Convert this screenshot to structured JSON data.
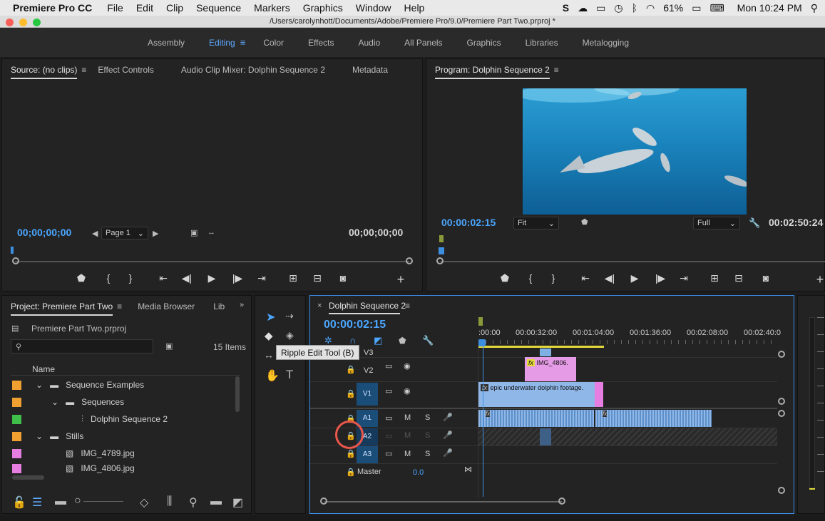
{
  "menubar": {
    "app": "Premiere Pro CC",
    "items": [
      "File",
      "Edit",
      "Clip",
      "Sequence",
      "Markers",
      "Graphics",
      "Window",
      "Help"
    ],
    "battery": "61%",
    "clock": "Mon 10:24 PM"
  },
  "window": {
    "title": "/Users/carolynhott/Documents/Adobe/Premiere Pro/9.0/Premiere Part Two.prproj *"
  },
  "workspaces": [
    "Assembly",
    "Editing",
    "Color",
    "Effects",
    "Audio",
    "All Panels",
    "Graphics",
    "Libraries",
    "Metalogging"
  ],
  "source": {
    "tabs": [
      "Source: (no clips)",
      "Effect Controls",
      "Audio Clip Mixer: Dolphin Sequence 2",
      "Metadata"
    ],
    "timecode_left": "00;00;00;00",
    "timecode_right": "00;00;00;00",
    "page_select": "Page 1"
  },
  "program": {
    "tab": "Program: Dolphin Sequence 2",
    "timecode": "00:00:02:15",
    "zoom": "Fit",
    "quality": "Full",
    "duration": "00:02:50:24"
  },
  "project": {
    "tabs": [
      "Project: Premiere Part Two",
      "Media Browser",
      "Lib"
    ],
    "file": "Premiere Part Two.prproj",
    "count": "15 Items",
    "column_name": "Name",
    "items": [
      {
        "label": "Sequence Examples",
        "color": "#f0a030",
        "type": "folder",
        "indent": 0
      },
      {
        "label": "Sequences",
        "color": "#f0a030",
        "type": "folder",
        "indent": 1
      },
      {
        "label": "Dolphin Sequence 2",
        "color": "#3fbf4a",
        "type": "sequence",
        "indent": 2
      },
      {
        "label": "Stills",
        "color": "#f0a030",
        "type": "folder",
        "indent": 0
      },
      {
        "label": "IMG_4789.jpg",
        "color": "#e57ee0",
        "type": "image",
        "indent": 1
      },
      {
        "label": "IMG_4806.jpg",
        "color": "#e57ee0",
        "type": "image",
        "indent": 1
      }
    ]
  },
  "tools": {
    "tooltip": "Ripple Edit Tool (B)"
  },
  "timeline": {
    "tab": "Dolphin Sequence 2",
    "timecode": "00:00:02:15",
    "ruler": [
      ":00:00",
      "00:00:32:00",
      "00:01:04:00",
      "00:01:36:00",
      "00:02:08:00",
      "00:02:40:0"
    ],
    "tracks": {
      "v3": "V3",
      "v2": "V2",
      "v1": "V1",
      "a1": "A1",
      "a2": "A2",
      "a3": "A3",
      "master": "Master",
      "master_value": "0.0",
      "m": "M",
      "s": "S"
    },
    "clips": {
      "v2_clip": "IMG_4806.",
      "v1_clip": "epic underwater dolphin footage."
    }
  }
}
